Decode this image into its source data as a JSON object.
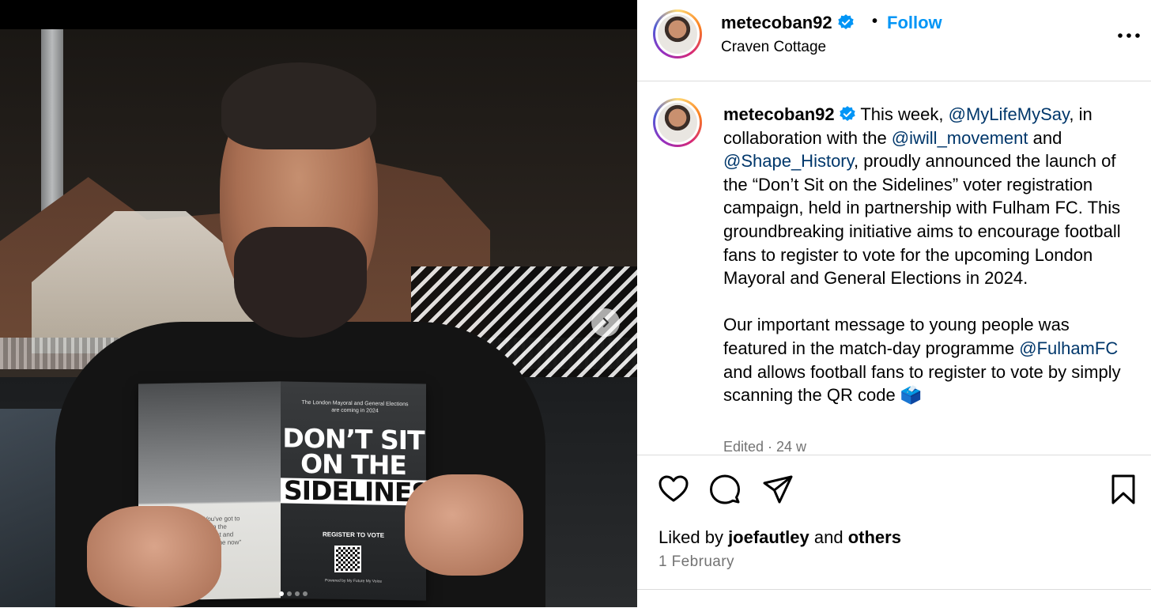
{
  "post": {
    "username": "metecoban92",
    "location": "Craven Cottage",
    "follow_label": "Follow",
    "separator": "•",
    "caption_parts": {
      "p1_a": " This week, ",
      "m1": "@MyLifeMySay",
      "p1_b": ", in collaboration with the ",
      "m2": "@iwill_movement",
      "p1_c": " and ",
      "m3": "@Shape_History",
      "p1_d": ", proudly announced the launch of the “Don’t Sit on the Sidelines” voter registration campaign, held in partnership with Fulham FC. This groundbreaking initiative aims to encourage football fans to register to vote for the upcoming London Mayoral and General Elections in 2024.",
      "p2_a": "Our important message to young people was featured in the match-day programme ",
      "m4": "@FulhamFC",
      "p2_b": " and allows football fans to register to vote by simply scanning the QR code 🗳️"
    },
    "edited": "Edited · 24 w",
    "likes_prefix": "Liked by ",
    "likes_user": "joefautley",
    "likes_and": " and ",
    "likes_others": "others",
    "date": "1 February"
  },
  "magazine": {
    "subheading": "The London Mayoral and General Elections are coming in 2024",
    "headline_1": "DON’T SIT",
    "headline_2": "ON THE",
    "headline_3": "SIDELINES",
    "cta": "REGISTER TO VOTE",
    "footer": "Powered by My Future My Voice",
    "quote": "“ You've got to live in the present and enjoy the now”"
  },
  "carousel": {
    "count": 4,
    "active": 0
  },
  "colors": {
    "accent": "#0095f6",
    "mention": "#00376b",
    "muted": "#737373",
    "border": "#dbdbdb",
    "verified": "#0095f6"
  },
  "icons": [
    "verified-badge-icon",
    "more-options-icon",
    "heart-icon",
    "comment-icon",
    "share-icon",
    "bookmark-icon",
    "chevron-right-icon"
  ]
}
